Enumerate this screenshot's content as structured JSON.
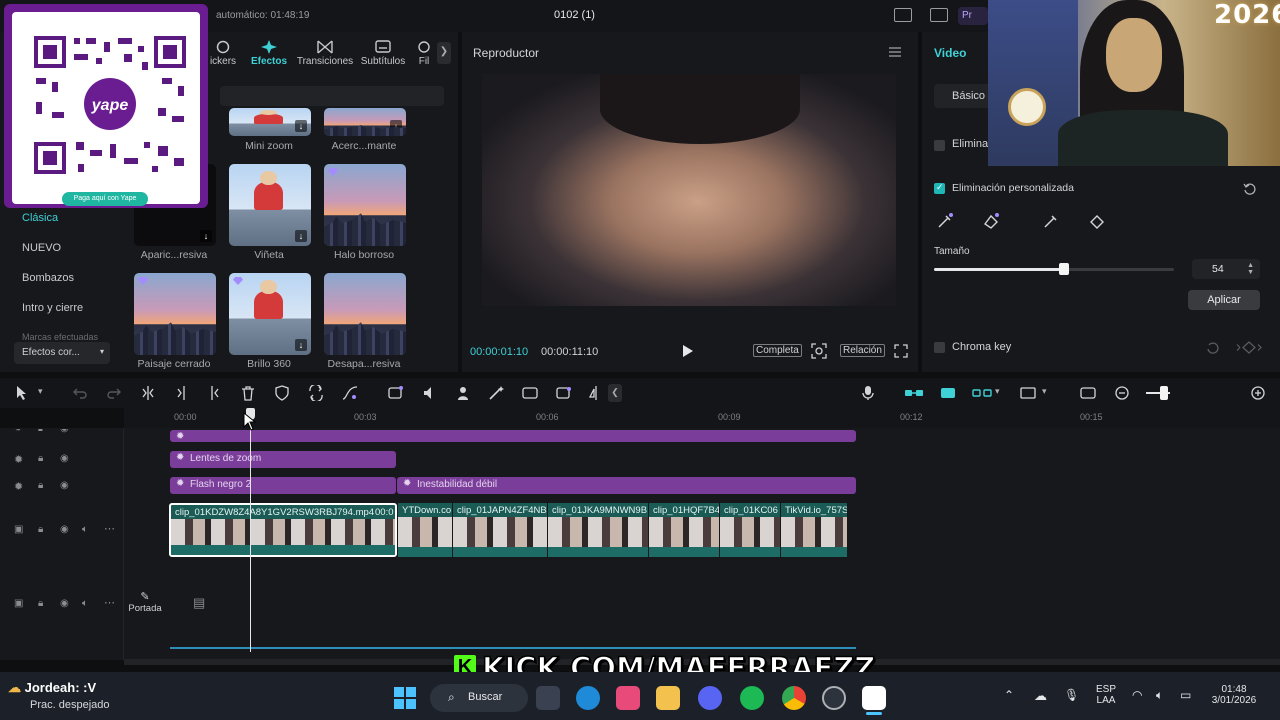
{
  "titlebar": {
    "autosave": "automático: 01:48:19",
    "project": "0102 (1)",
    "pro": "Pr"
  },
  "qr": {
    "caption": "Paga aquí con Yape",
    "brand": "yape"
  },
  "effects": {
    "tabs": [
      {
        "label": "ickers",
        "icon": "sticker-icon"
      },
      {
        "label": "Efectos",
        "icon": "sparkle-icon"
      },
      {
        "label": "Transiciones",
        "icon": "transition-icon"
      },
      {
        "label": "Subtítulos",
        "icon": "subtitle-icon"
      },
      {
        "label": "Fil",
        "icon": "filter-icon"
      }
    ],
    "sidebar": [
      "Clásica",
      "NUEVO",
      "Bombazos",
      "Intro y cierre",
      "Marcas efectuadas"
    ],
    "category_dropdown": "Efectos cor...",
    "items": [
      {
        "label": "Mini zoom"
      },
      {
        "label": "Acerc...mante"
      },
      {
        "label": "Aparic...resiva"
      },
      {
        "label": "Viñeta"
      },
      {
        "label": "Halo borroso"
      },
      {
        "label": "Paisaje cerrado"
      },
      {
        "label": "Brillo 360"
      },
      {
        "label": "Desapa...resiva"
      }
    ]
  },
  "player": {
    "title": "Reproductor",
    "current_time": "00:00:01:10",
    "total_time": "00:00:11:10",
    "btn_full": "Completa",
    "btn_ratio": "Relación"
  },
  "inspector": {
    "title": "Video",
    "tab_basic": "Básico",
    "remove_bg": "Elimina",
    "custom_removal": "Eliminación personalizada",
    "size_label": "Tamaño",
    "size_value": "54",
    "size_fraction": 0.54,
    "apply": "Aplicar",
    "chroma": "Chroma key"
  },
  "webcam": {
    "year": "2026"
  },
  "timeline": {
    "ticks": [
      "00:00",
      "00:03",
      "00:06",
      "00:09",
      "00:12",
      "00:15"
    ],
    "fx_clips": [
      "Lentes de zoom",
      "Flash negro 2",
      "Inestabilidad débil"
    ],
    "video_clips": [
      "clip_01KDZW8Z4A8Y1GV2RSW3RBJ794.mp4",
      "00:0",
      "YTDown.co",
      "clip_01JAPN4ZF4NB",
      "clip_01JKA9MNWN9B",
      "clip_01HQF7B4",
      "clip_01KC06",
      "TikVid.io_757S"
    ],
    "cover": "Portada"
  },
  "banner": {
    "text": "KICK.COM/MAFERRAEZZ",
    "k": "K"
  },
  "taskbar": {
    "user": "Jordeah: :V",
    "weather": "Prac. despejado",
    "search": "Buscar",
    "lang1": "ESP",
    "lang2": "LAA",
    "time": "01:48",
    "date": "3/01/2026"
  },
  "colors": {
    "accent": "#3ed1d6",
    "fx_clip": "#7a3d9a",
    "video_clip": "#1a5b56",
    "kick": "#53fc18",
    "qr_border": "#6a1d91"
  }
}
